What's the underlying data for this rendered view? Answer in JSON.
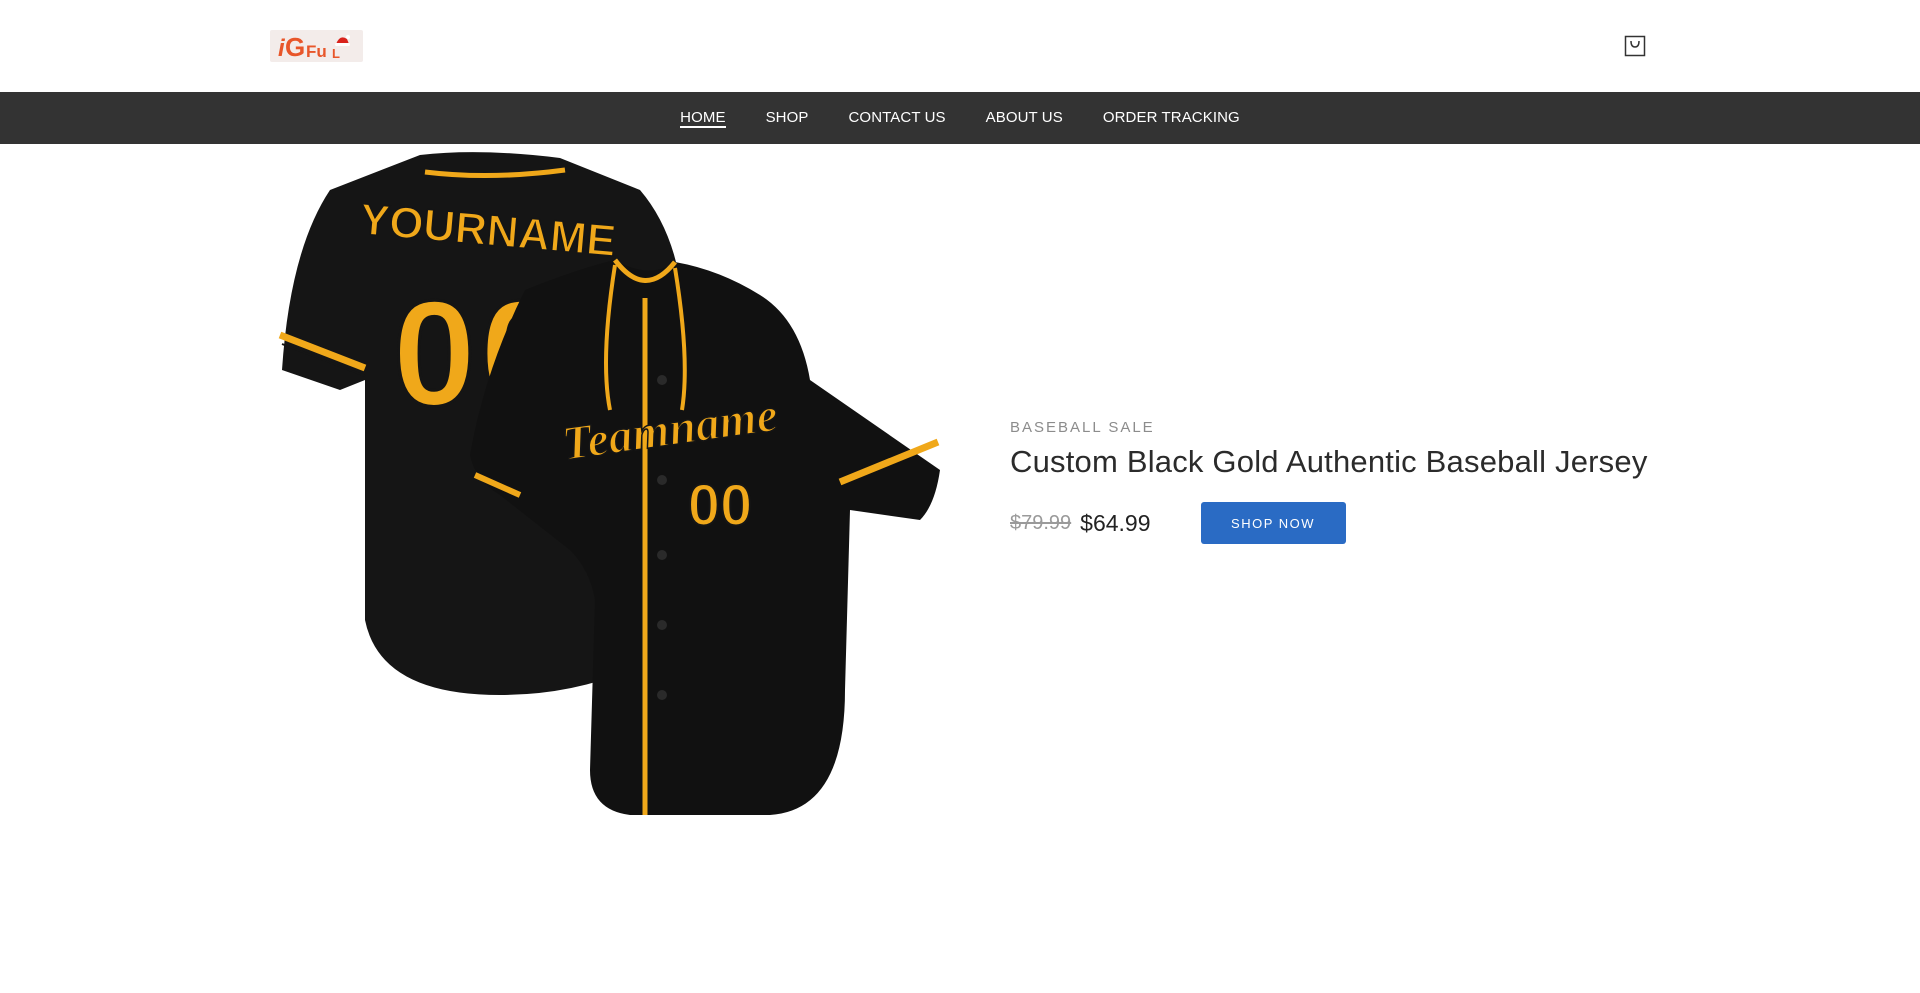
{
  "brand": {
    "logo_text": "iGFul"
  },
  "header": {
    "cart_icon": "shopping-bag-icon"
  },
  "nav": {
    "items": [
      {
        "label": "HOME",
        "active": true
      },
      {
        "label": "SHOP",
        "active": false
      },
      {
        "label": "CONTACT US",
        "active": false
      },
      {
        "label": "ABOUT US",
        "active": false
      },
      {
        "label": "ORDER TRACKING",
        "active": false
      }
    ]
  },
  "hero": {
    "image_front": {
      "team_text": "Teamname",
      "number": "00"
    },
    "image_back": {
      "name_text": "YOURNAME",
      "number": "00"
    },
    "eyebrow": "BASEBALL SALE",
    "title": "Custom Black Gold Authentic Baseball Jersey",
    "old_price": "$79.99",
    "new_price": "$64.99",
    "cta_label": "SHOP NOW"
  },
  "colors": {
    "nav_bg": "#333333",
    "cta_bg": "#2a6bc4",
    "jersey_black": "#151515",
    "jersey_gold": "#f0a81a",
    "logo_orange": "#e8562a"
  }
}
